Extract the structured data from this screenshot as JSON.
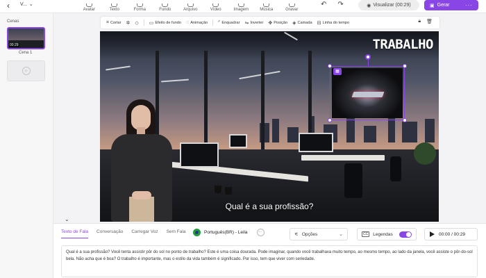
{
  "topbar": {
    "project_name": "V...",
    "tools": [
      "Avatar",
      "Texto",
      "Forma",
      "Fundo",
      "Arquivo",
      "Vídeo",
      "Imagem",
      "Música",
      "Gravar"
    ],
    "preview_label": "Visualizar (00:29)",
    "save_label": "Gerar"
  },
  "scenes": {
    "title": "Cenas",
    "items": [
      {
        "duration": "00:29",
        "label": "Cena 1"
      }
    ]
  },
  "context_toolbar": {
    "items": [
      "Cortar",
      "Efeito de fundo",
      "Animação",
      "Enquadrar",
      "Inverter",
      "Posição",
      "Camada",
      "Linha do tempo"
    ]
  },
  "canvas": {
    "title_text": "TRABALHO",
    "caption": "Qual é a sua profissão?"
  },
  "speech_panel": {
    "tabs": [
      "Texto de Fala",
      "Conversação",
      "Carregar Voz",
      "Sem Fala"
    ],
    "active_tab": 0,
    "voice": "Português(BR) - Leila",
    "options_label": "Opções",
    "subtitles_label": "Legendas",
    "subtitles_on": true,
    "time": "00:00 / 00:29",
    "text": "Qual é a sua profissão? Você tenta assistir pôr do sol no ponto de trabalho? Este é uma coisa dourada. Pode imaginar, quando você trabalhava muito tempo, ao mesmo tempo, ao lado da janela, você assiste o pôr-do-sol bela. Não acha que é boa? O trabalho é importante, mas o estilo da vida também é significado. Por isso, tem que viver com seriedade."
  },
  "colors": {
    "accent": "#8a45e6"
  }
}
